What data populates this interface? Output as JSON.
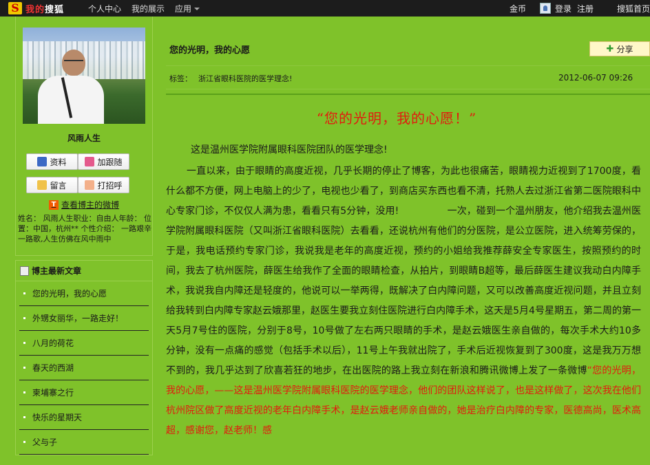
{
  "topbar": {
    "logo_s": "S",
    "logo_text_red": "我的",
    "logo_text": "搜狐",
    "nav": [
      "个人中心",
      "我的展示",
      "应用"
    ],
    "gold": "金币",
    "login": "登录",
    "register": "注册",
    "home": "搜狐首页"
  },
  "profile": {
    "name": "风雨人生",
    "buttons": {
      "info": "资料",
      "follow": "加跟随",
      "message": "留言",
      "greet": "打招呼"
    },
    "weibo_icon": "T",
    "weibo_link": "查看博主的微博",
    "info_text": "姓名： 风雨人生职业：自由人年龄： 位置：中国，杭州** 个性介绍： 一路艰辛一路歌,人生仿佛在风中雨中"
  },
  "articles": {
    "header": "博主最新文章",
    "items": [
      "您的光明，我的心愿",
      "外甥女丽华，一路走好！",
      "八月的荷花",
      "春天的西湖",
      "柬埔寨之行",
      "快乐的星期天",
      "父与子"
    ]
  },
  "post": {
    "title": "您的光明，我的心愿",
    "share": "分享",
    "tag_label": "标签：",
    "tag": "浙江省眼科医院的医学理念!",
    "date": "2012-06-07 09:26",
    "headline": "“您的光明，我的心愿！”",
    "para1": "这是温州医学院附属眼科医院团队的医学理念!",
    "para2_black": "一直以来，由于眼睛的高度近视，几乎长期的停止了博客，为此也很痛苦，眼睛视力近视到了1700度，看什么都不方便，网上电脑上的少了，电视也少看了，到商店买东西也看不清，托熟人去过浙江省第二医院眼科中心专家门诊，不仅仅人满为患，看看只有5分钟，没用!　　　　　一次，碰到一个温州朋友，他介绍我去温州医学院附属眼科医院（又叫浙江省眼科医院）去看看，还说杭州有他们的分医院，是公立医院，进入统筹劳保的，于是，我电话预约专家门诊，我说我是老年的高度近视，预约的小姐给我推荐薛安全专家医生，按照预约的时间，我去了杭州医院，薛医生给我作了全面的眼睛检查，从拍片，到眼睛B超等，最后薛医生建议我动白内障手术，我说我自内障还是轻度的，他说可以一举两得，既解决了白内障问题，又可以改善高度近视问题，并且立刻给我转到白内障专家赵云娥那里，赵医生要我立刻住医院进行白内障手术，这天是5月4号星期五，第二周的第一天5月7号住的医院，分别于8号，10号做了左右两只眼睛的手术，是赵云娥医生亲自做的，每次手术大约10多分钟，没有一点痛的感觉（包括手术以后），11号上午我就出院了，手术后近视恢复到了300度，这是我万万想不到的，我几乎达到了欣喜若狂的地步，在出医院的路上我立刻在新浪和腾讯微博上发了一条微博",
    "para2_red": "“您的光明，我的心愿，——这是温州医学院附属眼科医院的医学理念，他们的团队这样说了，也是这样做了，这次我在他们杭州院区做了高度近视的老年白内障手术，是赵云娥老师亲自做的，她是治疗白内障的专家，医德高尚，医术高超，感谢您，赵老师！感"
  },
  "colors": {
    "background": "#7fc22a",
    "topbar": "#1c1c1c",
    "accent_red": "#e21b0e"
  },
  "icons": [
    "sohu-logo-icon",
    "user-avatar-icon",
    "profile-icon",
    "follow-icon",
    "message-icon",
    "greet-icon",
    "weibo-icon",
    "document-icon",
    "share-plus-icon"
  ]
}
